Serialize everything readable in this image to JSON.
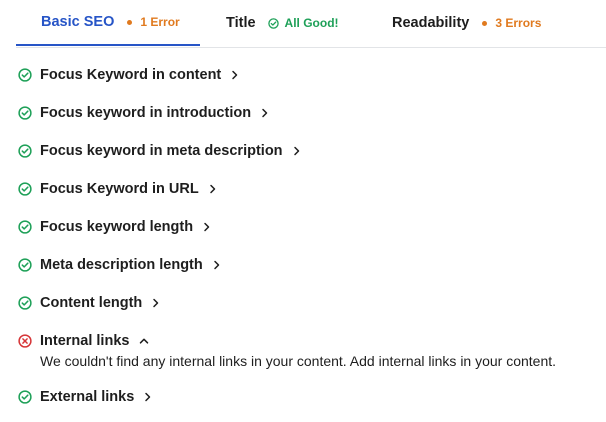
{
  "tabs": [
    {
      "label": "Basic SEO",
      "status": "1 Error",
      "status_type": "error",
      "active": true
    },
    {
      "label": "Title",
      "status": "All Good!",
      "status_type": "good",
      "active": false
    },
    {
      "label": "Readability",
      "status": "3 Errors",
      "status_type": "error",
      "active": false
    }
  ],
  "checks": [
    {
      "label": "Focus Keyword in content",
      "state": "pass",
      "expanded": false
    },
    {
      "label": "Focus keyword in introduction",
      "state": "pass",
      "expanded": false
    },
    {
      "label": "Focus keyword in meta description",
      "state": "pass",
      "expanded": false
    },
    {
      "label": "Focus Keyword in URL",
      "state": "pass",
      "expanded": false
    },
    {
      "label": "Focus keyword length",
      "state": "pass",
      "expanded": false
    },
    {
      "label": "Meta description length",
      "state": "pass",
      "expanded": false
    },
    {
      "label": "Content length",
      "state": "pass",
      "expanded": false
    },
    {
      "label": "Internal links",
      "state": "fail",
      "expanded": true,
      "detail": "We couldn't find any internal links in your content. Add internal links in your content."
    },
    {
      "label": "External links",
      "state": "pass",
      "expanded": false
    }
  ],
  "icons": {
    "pass": "check-circle-icon",
    "fail": "x-circle-icon",
    "collapsed": "chevron-right-icon",
    "expanded": "chevron-up-icon"
  },
  "colors": {
    "accent": "#2755c7",
    "error": "#e07a1f",
    "good": "#1ea058",
    "fail_icon": "#d63638",
    "text": "#1e1e1e"
  }
}
